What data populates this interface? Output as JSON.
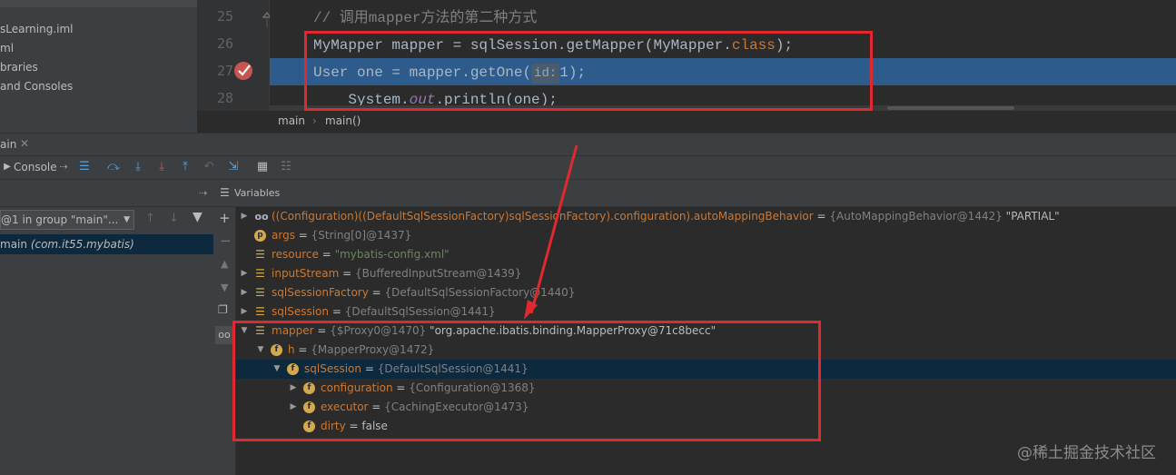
{
  "project_tree": [
    "sLearning.iml",
    "ml",
    "braries",
    "and Consoles"
  ],
  "editor": {
    "lines": [
      {
        "num": "25",
        "text": "// 调用mapper方法的第二种方式"
      },
      {
        "num": "26",
        "text": "MyMapper mapper = sqlSession.getMapper(MyMapper.",
        "kw": "class",
        "tail": ");"
      },
      {
        "num": "27",
        "text": "User one = mapper.getOne(",
        "hint": "id:",
        "tail": "1);"
      },
      {
        "num": "28",
        "text": "    System.",
        "italic": "out",
        "tail": ".println(one);"
      }
    ],
    "breadcrumb": [
      "main",
      "main()"
    ]
  },
  "debug": {
    "tab": "ain",
    "console_tab": "Console",
    "variables_label": "Variables",
    "thread_select": "@1 in group \"main\"...",
    "frame": {
      "name": "main",
      "location": "(com.it55.mybatis)"
    }
  },
  "variables": [
    {
      "indent": 0,
      "expand": "right",
      "icon": "oo",
      "name": "((Configuration)((DefaultSqlSessionFactory)sqlSessionFactory).configuration).autoMappingBehavior",
      "eq": " = ",
      "val": "{AutoMappingBehavior@1442}",
      "lit": " \"PARTIAL\""
    },
    {
      "indent": 0,
      "expand": "",
      "icon": "p",
      "name": "args",
      "eq": " = ",
      "val": "{String[0]@1437}"
    },
    {
      "indent": 0,
      "expand": "",
      "icon": "list",
      "name": "resource",
      "eq": " = ",
      "str": "\"mybatis-config.xml\""
    },
    {
      "indent": 0,
      "expand": "right",
      "icon": "list",
      "name": "inputStream",
      "eq": " = ",
      "val": "{BufferedInputStream@1439}"
    },
    {
      "indent": 0,
      "expand": "right",
      "icon": "list",
      "name": "sqlSessionFactory",
      "eq": " = ",
      "val": "{DefaultSqlSessionFactory@1440}"
    },
    {
      "indent": 0,
      "expand": "right",
      "icon": "list",
      "name": "sqlSession",
      "eq": " = ",
      "val": "{DefaultSqlSession@1441}"
    },
    {
      "indent": 0,
      "expand": "down",
      "icon": "list",
      "name": "mapper",
      "eq": " = ",
      "val": "{$Proxy0@1470}",
      "lit": " \"org.apache.ibatis.binding.MapperProxy@71c8becc\""
    },
    {
      "indent": 1,
      "expand": "down",
      "icon": "f",
      "name": "h",
      "eq": " = ",
      "val": "{MapperProxy@1472}"
    },
    {
      "indent": 2,
      "expand": "down",
      "icon": "f",
      "name": "sqlSession",
      "eq": " = ",
      "val": "{DefaultSqlSession@1441}",
      "selected": true
    },
    {
      "indent": 3,
      "expand": "right",
      "icon": "f",
      "name": "configuration",
      "eq": " = ",
      "val": "{Configuration@1368}"
    },
    {
      "indent": 3,
      "expand": "right",
      "icon": "f",
      "name": "executor",
      "eq": " = ",
      "val": "{CachingExecutor@1473}"
    },
    {
      "indent": 3,
      "expand": "",
      "icon": "f",
      "name": "dirty",
      "eq": " = ",
      "lit": "false"
    }
  ],
  "watermark": "@稀土掘金技术社区"
}
